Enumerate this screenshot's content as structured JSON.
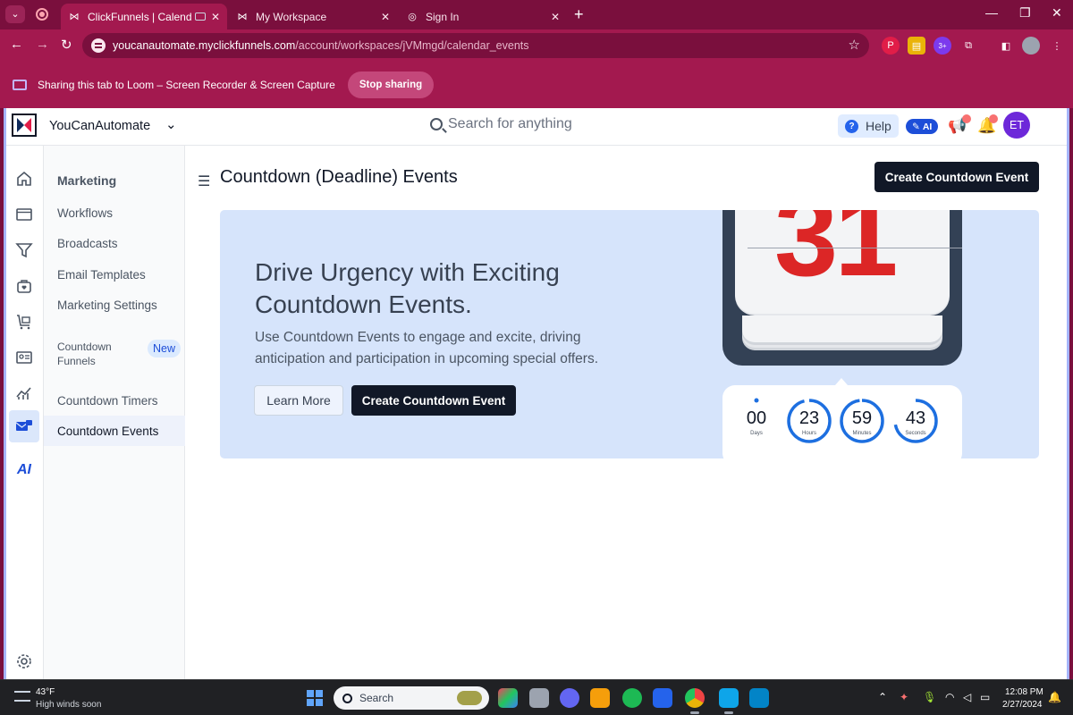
{
  "browser": {
    "tabs": [
      {
        "title": "ClickFunnels | Calendar Even",
        "active": true
      },
      {
        "title": "My Workspace",
        "active": false
      },
      {
        "title": "Sign In",
        "active": false
      }
    ],
    "url_host": "youcanautomate.myclickfunnels.com",
    "url_path": "/account/workspaces/jVMmgd/calendar_events",
    "loom_text": "Sharing this tab to Loom – Screen Recorder & Screen Capture",
    "stop_sharing": "Stop sharing",
    "ext_badge": "3+"
  },
  "header": {
    "workspace_name": "YouCanAutomate",
    "search_placeholder": "Search for anything",
    "help": "Help",
    "ai_badge": "AI",
    "avatar": "ET"
  },
  "rail": {
    "items": [
      "home-icon",
      "browser-icon",
      "funnel-icon",
      "store-icon",
      "cart-icon",
      "contact-card-icon",
      "analytics-icon",
      "marketing-icon",
      "ai-icon",
      "settings-icon"
    ],
    "active": "marketing-icon"
  },
  "subnav": {
    "heading": "Marketing",
    "items": [
      "Workflows",
      "Broadcasts",
      "Email Templates",
      "Marketing Settings"
    ],
    "countdown_funnels_line1": "Countdown",
    "countdown_funnels_line2": "Funnels",
    "new_badge": "New",
    "countdown_timers": "Countdown Timers",
    "countdown_events": "Countdown Events"
  },
  "main": {
    "title": "Countdown (Deadline) Events",
    "create_button": "Create Countdown Event",
    "hero": {
      "title": "Drive Urgency with Exciting Countdown Events.",
      "description": "Use Countdown Events to engage and excite, driving anticipation and participation in upcoming special offers.",
      "learn_more": "Learn More",
      "create_button": "Create Countdown Event",
      "calendar_day": "31",
      "timer": [
        {
          "value": "00",
          "label": "Days",
          "fill": 0
        },
        {
          "value": "23",
          "label": "Hours",
          "fill": 0.96
        },
        {
          "value": "59",
          "label": "Minutes",
          "fill": 0.98
        },
        {
          "value": "43",
          "label": "Seconds",
          "fill": 0.72
        }
      ]
    }
  },
  "taskbar": {
    "temperature": "43°F",
    "weather": "High winds soon",
    "search": "Search",
    "time": "12:08 PM",
    "date": "2/27/2024"
  },
  "colors": {
    "browser_frame": "#7a0f3d",
    "browser_toolbar": "#a3194f",
    "dark_button": "#111827",
    "hero_bg": "#d6e4fb",
    "timer_ring": "#1d6fe0",
    "calendar_red": "#dc2626"
  }
}
